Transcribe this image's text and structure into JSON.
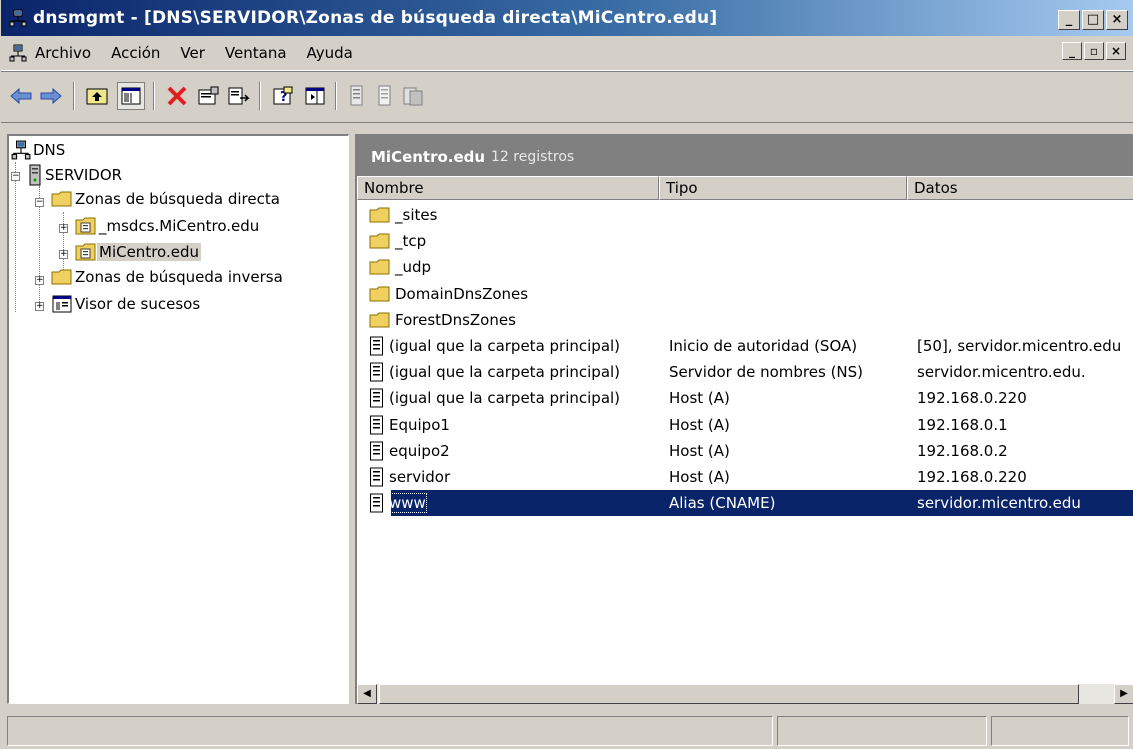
{
  "window": {
    "title": "dnsmgmt - [DNS\\SERVIDOR\\Zonas de búsqueda directa\\MiCentro.edu]",
    "caption_buttons": [
      "_",
      "□",
      "×"
    ]
  },
  "menubar": {
    "items": [
      {
        "label": "Archivo"
      },
      {
        "label": "Acción"
      },
      {
        "label": "Ver"
      },
      {
        "label": "Ventana"
      },
      {
        "label": "Ayuda"
      }
    ],
    "mdi_buttons": [
      "_",
      "▫",
      "×"
    ]
  },
  "toolbar": {
    "icons": [
      "back-arrow-icon",
      "forward-arrow-icon",
      "up-folder-icon",
      "show-hide-tree-icon",
      "delete-icon",
      "properties-icon",
      "export-list-icon",
      "help-icon",
      "action-pane-icon",
      "new-record-icon",
      "new-record2-icon",
      "new-domain-icon"
    ]
  },
  "tree": {
    "nodes": [
      {
        "label": "DNS"
      },
      {
        "label": "SERVIDOR"
      },
      {
        "label": "Zonas de búsqueda directa"
      },
      {
        "label": "_msdcs.MiCentro.edu"
      },
      {
        "label": "MiCentro.edu"
      },
      {
        "label": "Zonas de búsqueda inversa"
      },
      {
        "label": "Visor de sucesos"
      }
    ]
  },
  "zone": {
    "name": "MiCentro.edu",
    "count": "12 registros"
  },
  "columns": [
    "Nombre",
    "Tipo",
    "Datos"
  ],
  "rows": [
    {
      "name": "_sites",
      "type": "",
      "data": "",
      "icon": "folder"
    },
    {
      "name": "_tcp",
      "type": "",
      "data": "",
      "icon": "folder"
    },
    {
      "name": "_udp",
      "type": "",
      "data": "",
      "icon": "folder"
    },
    {
      "name": "DomainDnsZones",
      "type": "",
      "data": "",
      "icon": "folder"
    },
    {
      "name": "ForestDnsZones",
      "type": "",
      "data": "",
      "icon": "folder"
    },
    {
      "name": "(igual que la carpeta principal)",
      "type": "Inicio de autoridad (SOA)",
      "data": "[50], servidor.micentro.edu",
      "icon": "record"
    },
    {
      "name": "(igual que la carpeta principal)",
      "type": "Servidor de nombres (NS)",
      "data": "servidor.micentro.edu.",
      "icon": "record"
    },
    {
      "name": "(igual que la carpeta principal)",
      "type": "Host (A)",
      "data": "192.168.0.220",
      "icon": "record"
    },
    {
      "name": "Equipo1",
      "type": "Host (A)",
      "data": "192.168.0.1",
      "icon": "record"
    },
    {
      "name": "equipo2",
      "type": "Host (A)",
      "data": "192.168.0.2",
      "icon": "record"
    },
    {
      "name": "servidor",
      "type": "Host (A)",
      "data": "192.168.0.220",
      "icon": "record"
    },
    {
      "name": "www",
      "type": "Alias (CNAME)",
      "data": "servidor.micentro.edu",
      "icon": "record",
      "selected": true
    }
  ],
  "colors": {
    "title_start": "#0a246a",
    "title_end": "#a6caf0",
    "selection": "#0a246a",
    "chrome": "#d4d0c8"
  }
}
